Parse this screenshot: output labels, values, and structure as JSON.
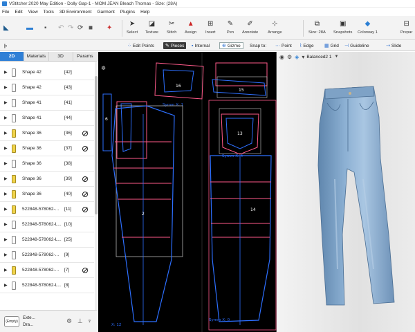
{
  "titlebar": {
    "title": "VStitcher 2020 May Edition - Dolly Gap-1 - MOM JEAN Bleach Thomas - Size: (28A)"
  },
  "menu": [
    "File",
    "Edit",
    "View",
    "Tools",
    "3D Environment",
    "Garment",
    "Plugins",
    "Help"
  ],
  "toolbar": {
    "select": "Select",
    "texture": "Texture",
    "stitch": "Stitch",
    "assign": "Assign",
    "insert": "Insert",
    "pen": "Pen",
    "annotate": "Annotate",
    "arrange": "Arrange",
    "size": "Size: 28A",
    "snapshots": "Snapshots",
    "colorway": "Colorway 1",
    "prepare": "Prepar"
  },
  "subbar": {
    "edit_points": "Edit Points",
    "pieces": "Pieces",
    "internal": "Internal",
    "gizmo": "Gizmo",
    "snap_to": "Snap to:",
    "point": "Point",
    "edge": "Edge",
    "grid": "Grid",
    "guideline": "Guideline",
    "slide": "Slide"
  },
  "panel_tabs": [
    "2D",
    "Materials",
    "3D",
    "Params"
  ],
  "list": [
    {
      "name": "Shape 42",
      "num": "[42]",
      "yellow": false,
      "ban": false
    },
    {
      "name": "Shape 42",
      "num": "[43]",
      "yellow": false,
      "ban": false
    },
    {
      "name": "Shape 41",
      "num": "[41]",
      "yellow": false,
      "ban": false
    },
    {
      "name": "Shape 41",
      "num": "[44]",
      "yellow": false,
      "ban": false
    },
    {
      "name": "Shape 36",
      "num": "[36]",
      "yellow": true,
      "ban": true
    },
    {
      "name": "Shape 36",
      "num": "[37]",
      "yellow": true,
      "ban": true
    },
    {
      "name": "Shape 36",
      "num": "[38]",
      "yellow": false,
      "ban": false
    },
    {
      "name": "Shape 36",
      "num": "[39]",
      "yellow": true,
      "ban": true
    },
    {
      "name": "Shape 36",
      "num": "[40]",
      "yellow": true,
      "ban": true
    },
    {
      "name": "522848-578062-...",
      "num": "[11]",
      "yellow": true,
      "ban": true
    },
    {
      "name": "522848-578062-L...",
      "num": "[10]",
      "yellow": false,
      "ban": false
    },
    {
      "name": "522848-578062-L...",
      "num": "[25]",
      "yellow": false,
      "ban": false
    },
    {
      "name": "522848-578062-...",
      "num": "[9]",
      "yellow": false,
      "ban": false
    },
    {
      "name": "522848-578062-...",
      "num": "[7]",
      "yellow": true,
      "ban": true
    },
    {
      "name": "522848-578062-L...",
      "num": "[8]",
      "yellow": false,
      "ban": false
    }
  ],
  "bottom": {
    "empty": "(Empty)",
    "ext": "Exte...",
    "dra": "Dra..."
  },
  "view2d": {
    "labels": [
      "16",
      "15",
      "6",
      "13",
      "2",
      "14"
    ],
    "symm": [
      "Symm X: 1",
      "Symm X: 4",
      "X: 12",
      "Symm X: 0"
    ]
  },
  "view3d": {
    "preset": "Balanced2 1"
  },
  "colors": {
    "accent": "#2f7fd6",
    "pattern_blue": "#2d6fff",
    "pattern_red": "#ff5a8a"
  }
}
